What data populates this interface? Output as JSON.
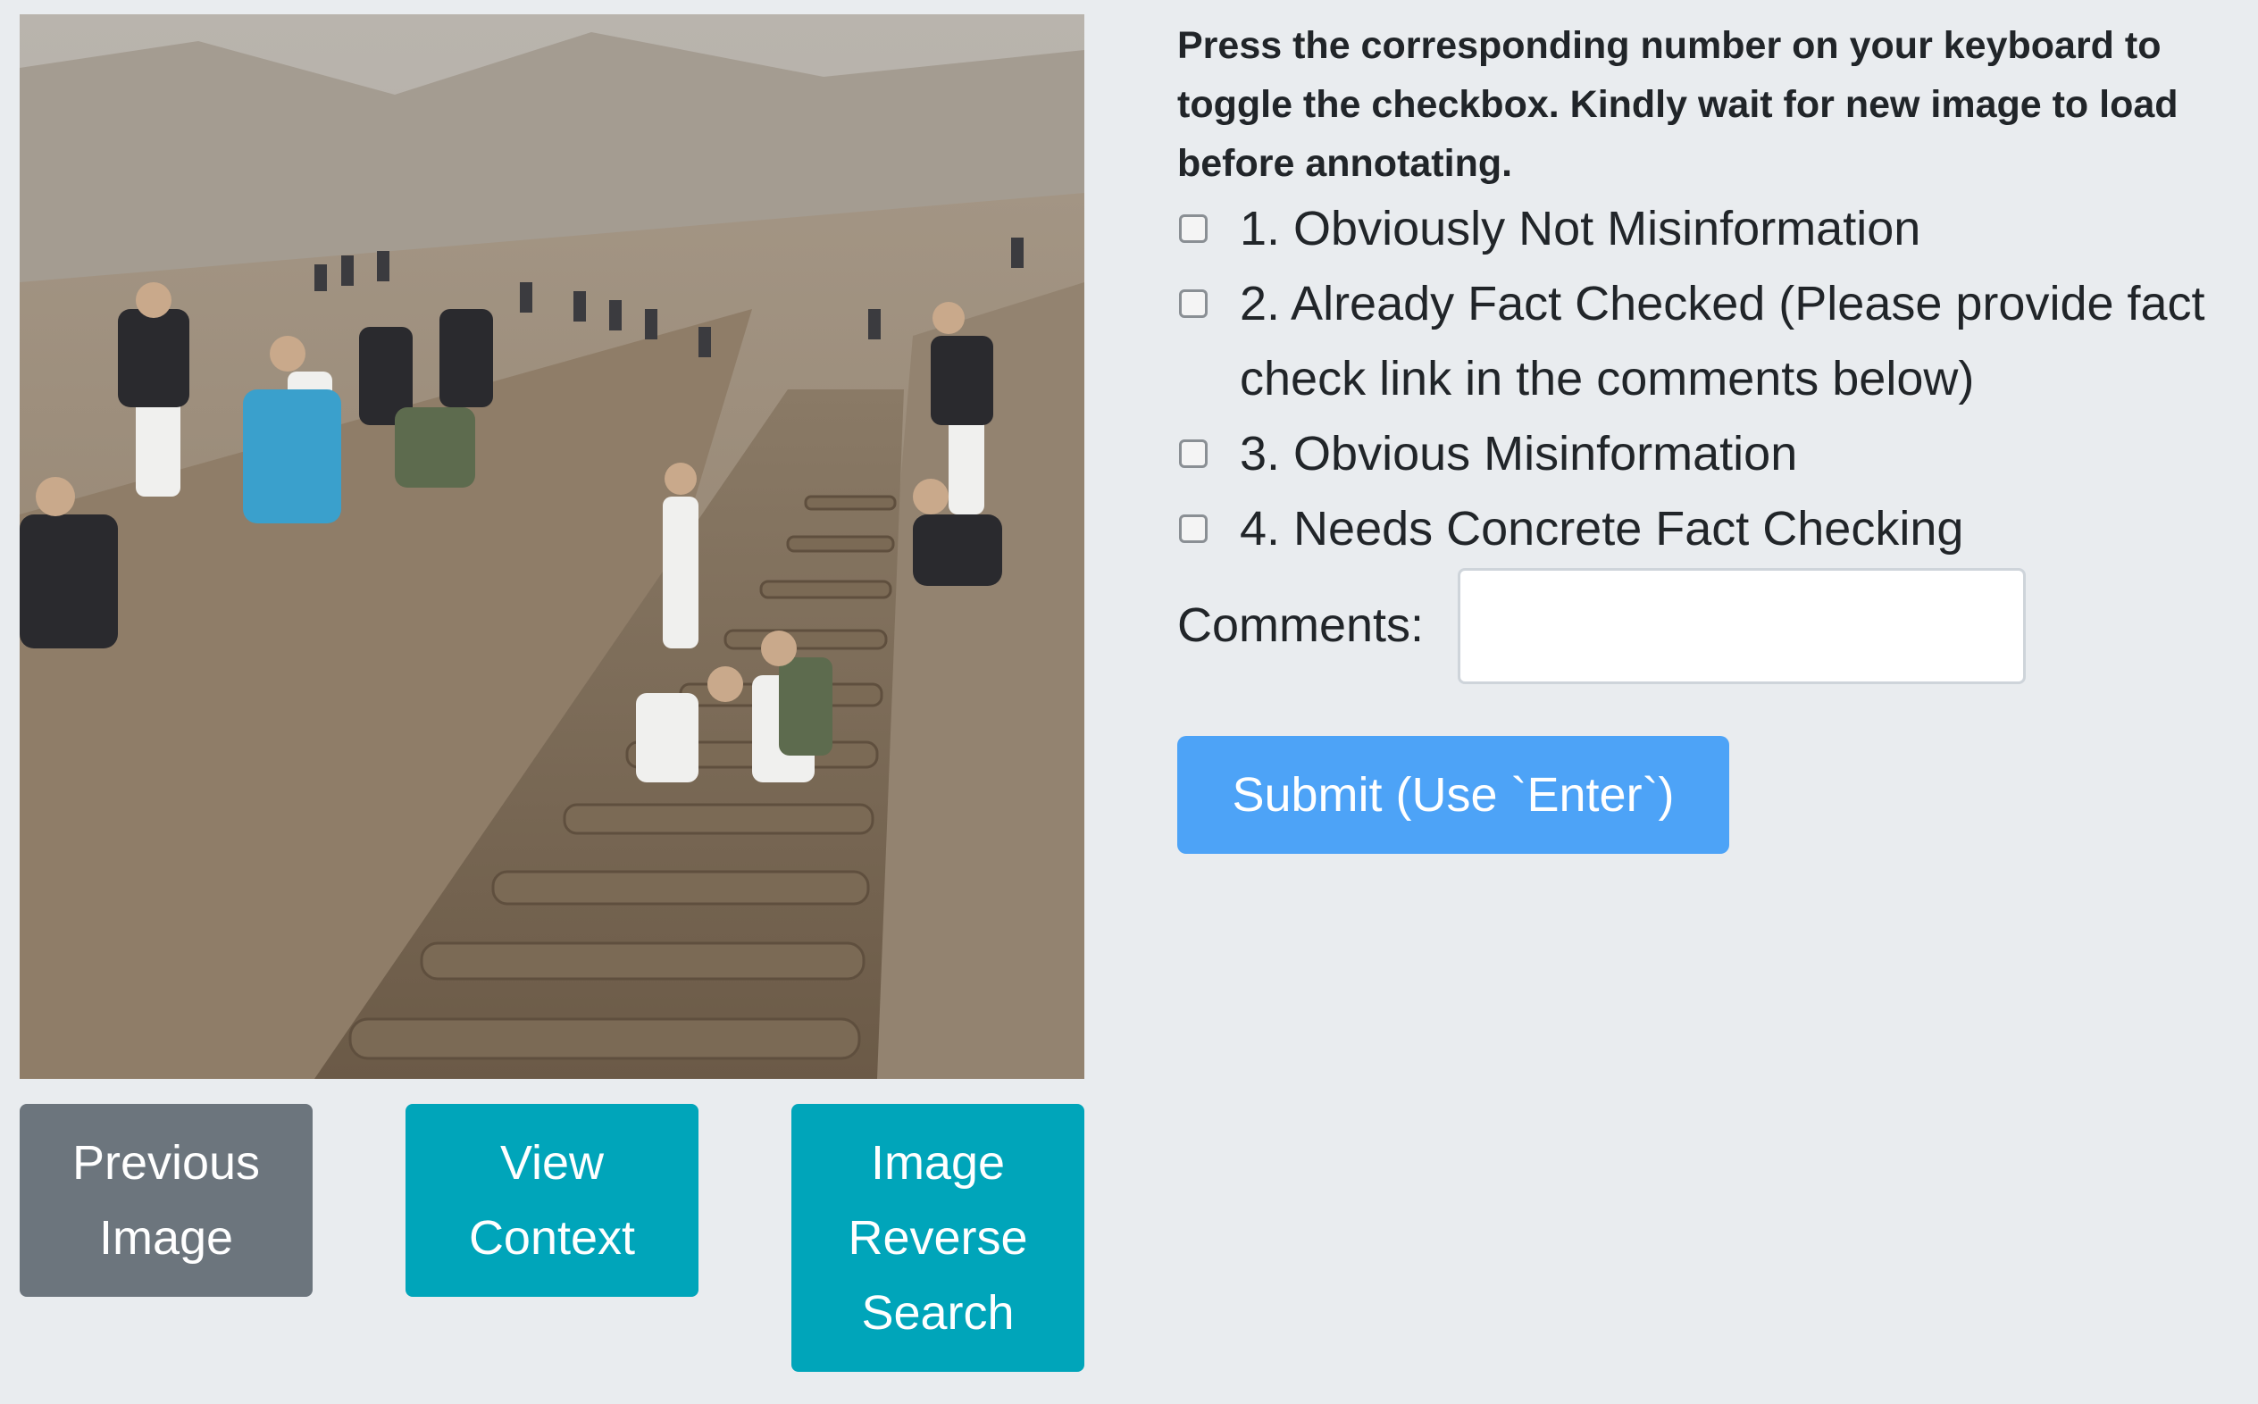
{
  "image": {
    "alt_name": "annotation-image"
  },
  "buttons": {
    "previous": [
      "Previous",
      "Image"
    ],
    "context": [
      "View",
      "Context"
    ],
    "reverse_search": [
      "Image",
      "Reverse",
      "Search"
    ]
  },
  "form": {
    "instructions": "Press the corresponding number on your keyboard to toggle the checkbox. Kindly wait for new image to load before annotating.",
    "options": [
      {
        "label": "1. Obviously Not Misinformation",
        "checked": false
      },
      {
        "label": "2. Already Fact Checked (Please provide fact check link in the comments below)",
        "checked": false
      },
      {
        "label": "3. Obvious Misinformation",
        "checked": false
      },
      {
        "label": "4. Needs Concrete Fact Checking",
        "checked": false
      }
    ],
    "comments_label": "Comments:",
    "comments_value": "",
    "submit_label": "Submit (Use `Enter`)"
  },
  "colors": {
    "background": "#e9ecef",
    "secondary_button": "#6c757d",
    "info_button": "#00a5ba",
    "primary_button": "#4da3f7"
  }
}
